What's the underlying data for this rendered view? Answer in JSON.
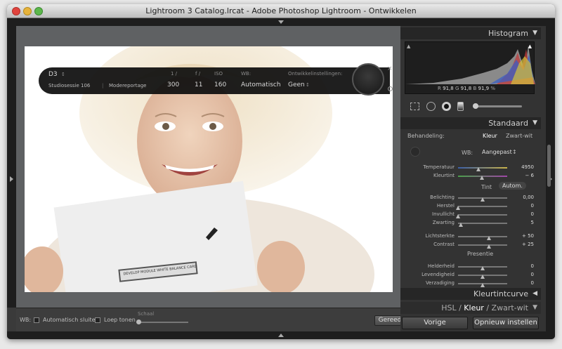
{
  "window": {
    "title": "Lightroom 3 Catalog.lrcat - Adobe Photoshop Lightroom - Ontwikkelen"
  },
  "overlay": {
    "camera": "D3",
    "session": "Studiosessie 106",
    "category": "Modereportage",
    "shutter_label": "1 /",
    "shutter": "300",
    "aperture_label": "f /",
    "aperture": "11",
    "iso_label": "ISO",
    "iso": "160",
    "wb_label": "WB:",
    "wb_value": "Automatisch",
    "develop_label": "Ontwikkelinstellingen:",
    "develop_value": "Geen"
  },
  "card": {
    "text": "DEVELOP MODULE WHITE BALANCE CARD"
  },
  "toolbar": {
    "wb": "WB:",
    "auto_close": "Automatisch sluiten",
    "loupe": "Loep tonen",
    "scale": "Schaal",
    "done": "Gereed"
  },
  "histogram": {
    "title": "Histogram",
    "r_label": "R",
    "r": "91,8",
    "g_label": "G",
    "g": "91,8",
    "b_label": "B",
    "b": "91,9",
    "pct": "%"
  },
  "basic": {
    "title": "Standaard",
    "treatment_label": "Behandeling:",
    "color": "Kleur",
    "bw": "Zwart-wit",
    "wb_label": "WB:",
    "wb_value": "Aangepast",
    "tone": "Tint",
    "auto": "Autom.",
    "presence": "Presentie",
    "sliders": [
      {
        "label": "Temperatuur",
        "value": "4950",
        "pos": 0.42
      },
      {
        "label": "Kleurtint",
        "value": "− 6",
        "pos": 0.48
      },
      {
        "label": "Belichting",
        "value": "0,00",
        "pos": 0.5
      },
      {
        "label": "Herstel",
        "value": "0",
        "pos": 0.0
      },
      {
        "label": "Invullicht",
        "value": "0",
        "pos": 0.0
      },
      {
        "label": "Zwarting",
        "value": "5",
        "pos": 0.05
      },
      {
        "label": "Lichtsterkte",
        "value": "+ 50",
        "pos": 0.63
      },
      {
        "label": "Contrast",
        "value": "+ 25",
        "pos": 0.63
      },
      {
        "label": "Helderheid",
        "value": "0",
        "pos": 0.5
      },
      {
        "label": "Levendigheid",
        "value": "0",
        "pos": 0.5
      },
      {
        "label": "Verzadiging",
        "value": "0",
        "pos": 0.5
      }
    ]
  },
  "panels": {
    "tone_curve": "Kleurtintcurve",
    "hsl": "HSL",
    "sep1": "/",
    "color": "Kleur",
    "sep2": "/",
    "bw": "Zwart-wit"
  },
  "buttons": {
    "previous": "Vorige",
    "reset": "Opnieuw instellen"
  }
}
